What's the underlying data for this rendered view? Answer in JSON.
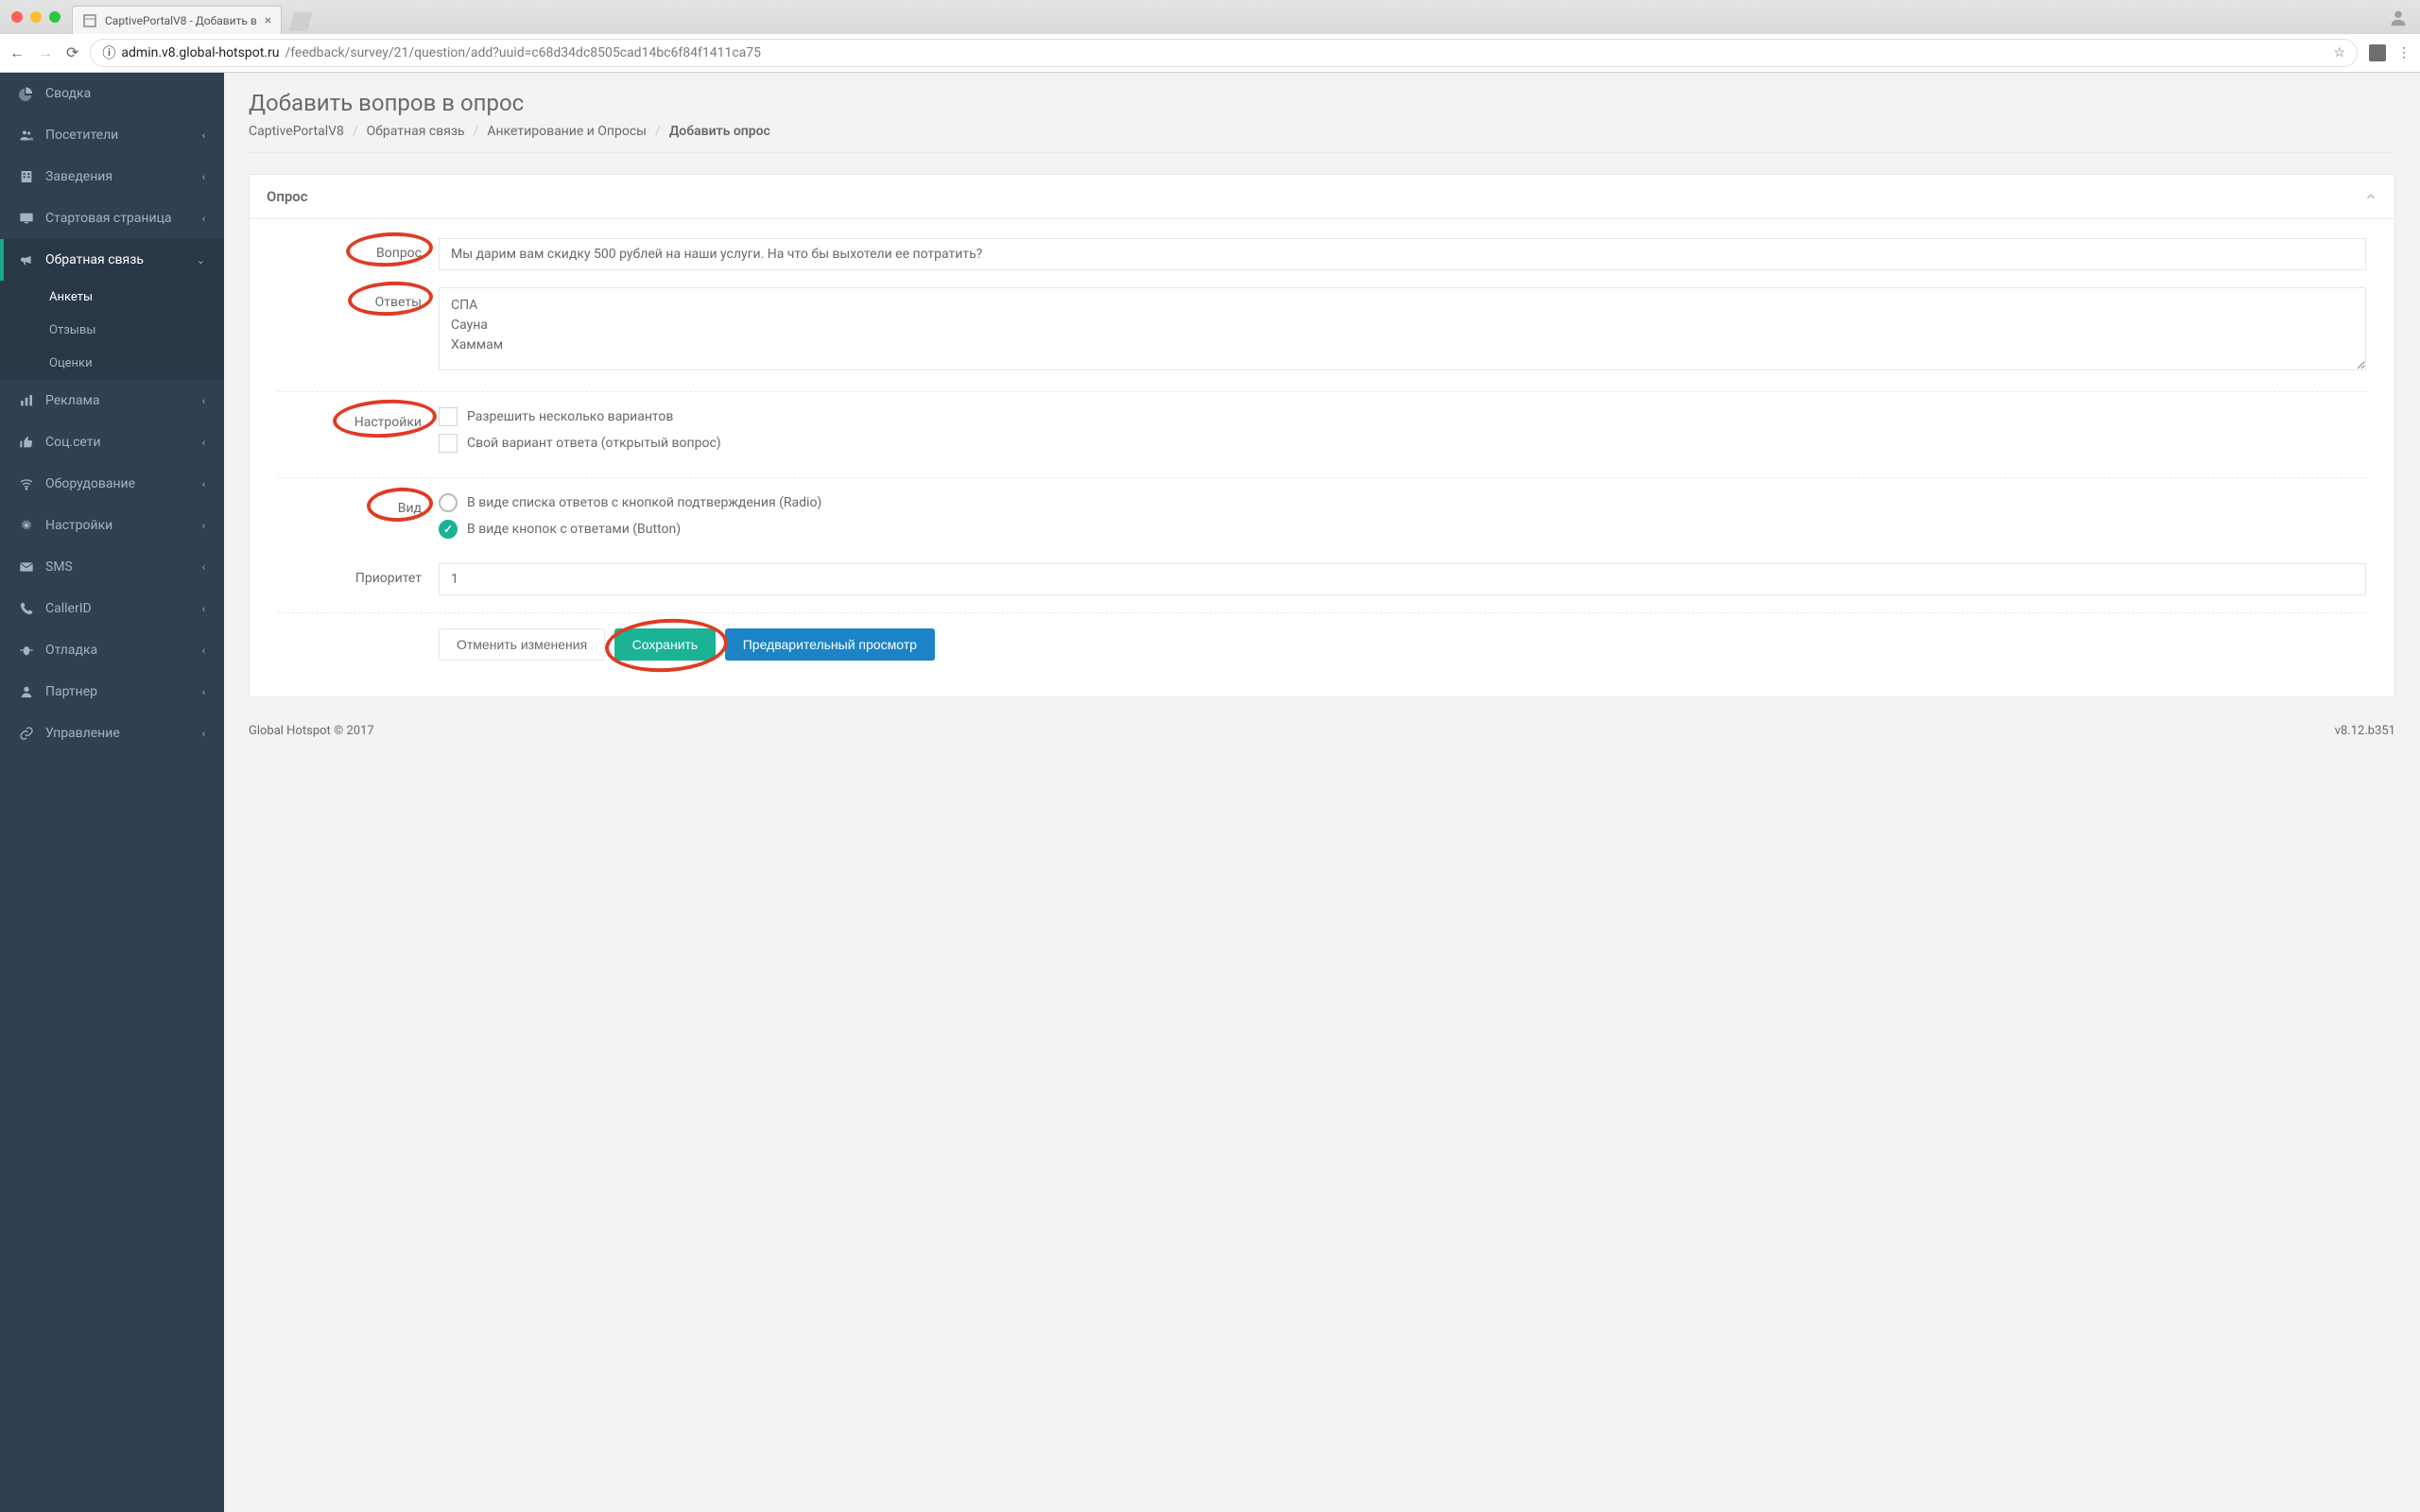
{
  "browser": {
    "tab_title": "CaptivePortalV8 - Добавить в",
    "url_domain": "admin.v8.global-hotspot.ru",
    "url_path": "/feedback/survey/21/question/add?uuid=c68d34dc8505cad14bc6f84f1411ca75"
  },
  "sidebar": {
    "items": [
      {
        "icon": "pie-icon",
        "label": "Сводка",
        "expandable": false
      },
      {
        "icon": "users-icon",
        "label": "Посетители",
        "expandable": true
      },
      {
        "icon": "building-icon",
        "label": "Заведения",
        "expandable": true
      },
      {
        "icon": "desktop-icon",
        "label": "Стартовая страница",
        "expandable": true
      },
      {
        "icon": "bullhorn-icon",
        "label": "Обратная связь",
        "expandable": true,
        "active": true,
        "children": [
          {
            "label": "Анкеты",
            "active": true
          },
          {
            "label": "Отзывы"
          },
          {
            "label": "Оценки"
          }
        ]
      },
      {
        "icon": "chart-icon",
        "label": "Реклама",
        "expandable": true
      },
      {
        "icon": "thumbs-icon",
        "label": "Соц.сети",
        "expandable": true
      },
      {
        "icon": "wifi-icon",
        "label": "Оборудование",
        "expandable": true
      },
      {
        "icon": "cogs-icon",
        "label": "Настройки",
        "expandable": true
      },
      {
        "icon": "envelope-icon",
        "label": "SMS",
        "expandable": true
      },
      {
        "icon": "phone-icon",
        "label": "CallerID",
        "expandable": true
      },
      {
        "icon": "bug-icon",
        "label": "Отладка",
        "expandable": true
      },
      {
        "icon": "user-icon",
        "label": "Партнер",
        "expandable": true
      },
      {
        "icon": "link-icon",
        "label": "Управление",
        "expandable": true
      }
    ]
  },
  "page": {
    "title": "Добавить вопров в опрос",
    "breadcrumb": [
      "CaptivePortalV8",
      "Обратная связь",
      "Анкетирование и Опросы",
      "Добавить опрос"
    ]
  },
  "panel": {
    "title": "Опрос"
  },
  "form": {
    "labels": {
      "question": "Вопрос",
      "answers": "Ответы",
      "settings": "Настройки",
      "view": "Вид",
      "priority": "Приоритет"
    },
    "question_value": "Мы дарим вам скидку 500 рублей на наши услуги. На что бы выхотели ее потратить?",
    "answers_value": "СПА\nСауна\nХаммам",
    "settings_options": [
      "Разрешить несколько вариантов",
      "Свой вариант ответа (открытый вопрос)"
    ],
    "view_options": [
      {
        "label": "В виде списка ответов с кнопкой подтверждения (Radio)",
        "checked": false
      },
      {
        "label": "В виде кнопок с ответами (Button)",
        "checked": true
      }
    ],
    "priority_value": "1",
    "buttons": {
      "cancel": "Отменить изменения",
      "save": "Сохранить",
      "preview": "Предварительный просмотр"
    }
  },
  "footer": {
    "copyright": "Global Hotspot © 2017",
    "version": "v8.12.b351"
  }
}
